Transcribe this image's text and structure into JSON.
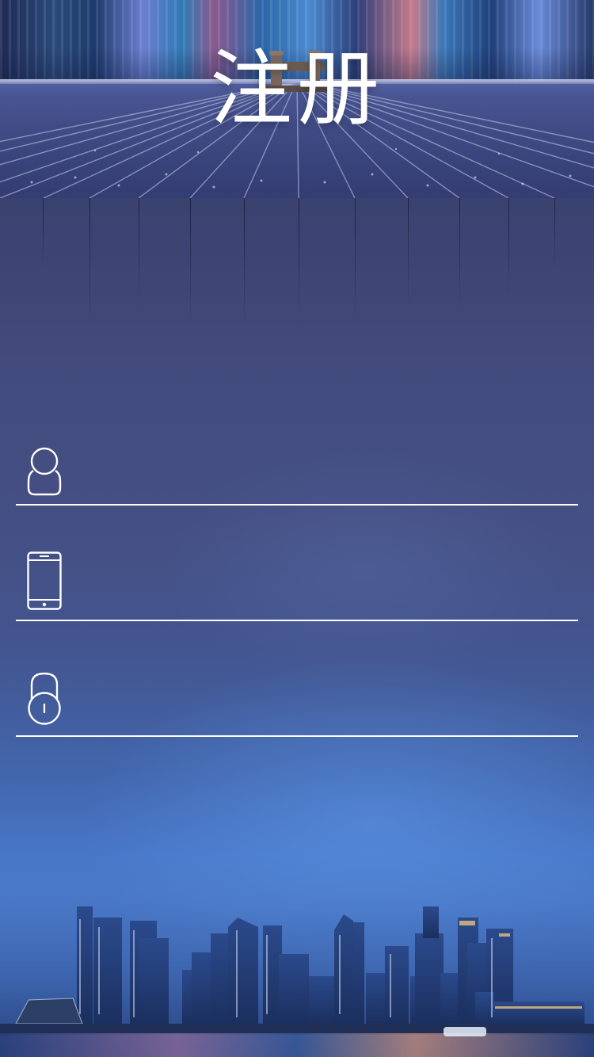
{
  "page": {
    "title": "注册"
  },
  "form": {
    "username": {
      "icon": "user-icon",
      "value": "",
      "placeholder": ""
    },
    "phone": {
      "icon": "phone-icon",
      "value": "",
      "placeholder": ""
    },
    "password": {
      "icon": "lock-icon",
      "value": "",
      "placeholder": ""
    }
  },
  "colors": {
    "underline": "#ffffff",
    "icon": "#ffffff",
    "background_top": "#3e4471",
    "background_bottom": "#4877c8"
  }
}
